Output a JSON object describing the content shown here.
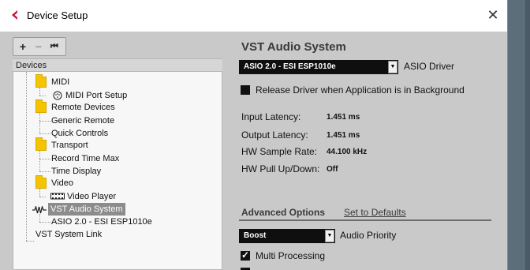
{
  "window": {
    "title": "Device Setup",
    "close_glyph": "✕",
    "icon": "cubase-logo-icon",
    "accent_color": "#c8102e"
  },
  "toolbar": {
    "add_glyph": "+",
    "remove_glyph": "−",
    "reset_glyph": "⏮"
  },
  "devices": {
    "header": "Devices",
    "items": [
      {
        "label": "MIDI",
        "type": "folder"
      },
      {
        "label": "MIDI Port Setup",
        "type": "child",
        "icon": "midi-port-icon"
      },
      {
        "label": "Remote Devices",
        "type": "folder"
      },
      {
        "label": "Generic Remote",
        "type": "child"
      },
      {
        "label": "Quick Controls",
        "type": "child"
      },
      {
        "label": "Transport",
        "type": "folder"
      },
      {
        "label": "Record Time Max",
        "type": "child"
      },
      {
        "label": "Time Display",
        "type": "child"
      },
      {
        "label": "Video",
        "type": "folder"
      },
      {
        "label": "Video Player",
        "type": "child",
        "icon": "video-player-icon"
      },
      {
        "label": "VST Audio System",
        "type": "item",
        "icon": "vst-audio-icon",
        "selected": true
      },
      {
        "label": "ASIO 2.0 - ESI ESP1010e",
        "type": "child"
      },
      {
        "label": "VST System Link",
        "type": "item"
      }
    ]
  },
  "panel": {
    "title": "VST Audio System",
    "driver": {
      "value": "ASIO 2.0 - ESI ESP1010e",
      "label": "ASIO Driver"
    },
    "release_driver": {
      "label": "Release Driver when Application is in Background",
      "checked": false
    },
    "info": [
      {
        "label": "Input Latency:",
        "value": "1.451 ms"
      },
      {
        "label": "Output Latency:",
        "value": "1.451 ms"
      },
      {
        "label": "HW Sample Rate:",
        "value": "44.100 kHz"
      },
      {
        "label": "HW Pull Up/Down:",
        "value": "Off"
      }
    ],
    "advanced": {
      "title": "Advanced Options",
      "defaults_link": "Set to Defaults",
      "priority": {
        "value": "Boost",
        "label": "Audio Priority"
      },
      "multi_processing": {
        "label": "Multi Processing",
        "checked": true
      }
    }
  }
}
